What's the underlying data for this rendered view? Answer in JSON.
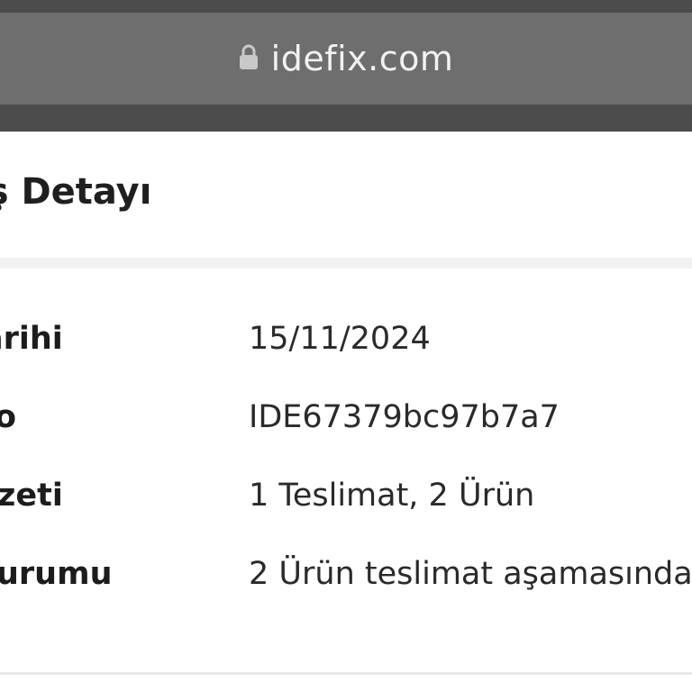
{
  "browser": {
    "url": "idefix.com",
    "lock_icon": "lock-icon"
  },
  "page": {
    "title": "iş Detayı"
  },
  "details": [
    {
      "label": "arihi",
      "value": "15/11/2024"
    },
    {
      "label": "o",
      "value": "IDE67379bc97b7a7"
    },
    {
      "label": "zeti",
      "value": "1 Teslimat, 2 Ürün"
    },
    {
      "label": "urumu",
      "value": "2 Ürün teslimat aşamasında"
    }
  ]
}
